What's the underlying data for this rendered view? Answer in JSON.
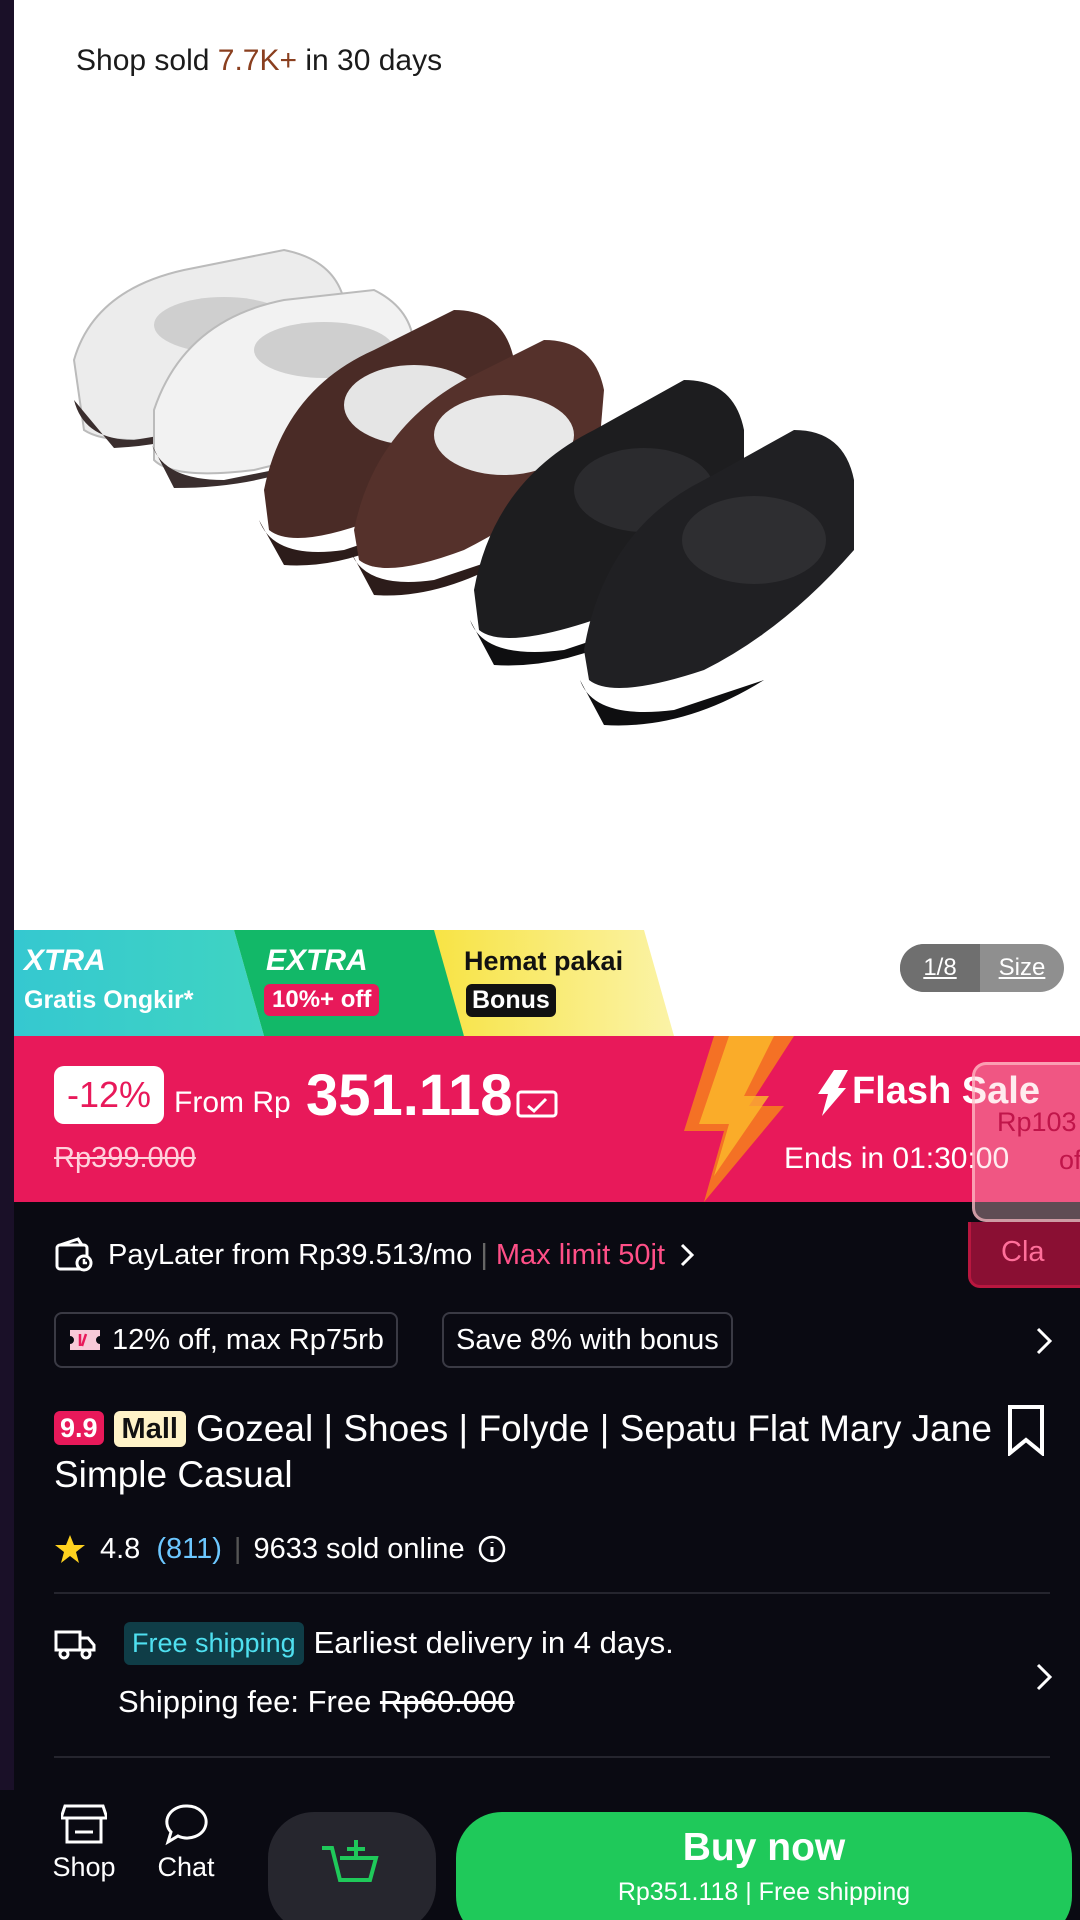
{
  "hero": {
    "sold_prefix": "Shop sold ",
    "sold_value": "7.7K+",
    "sold_suffix": " in 30 days",
    "pager": "1/8",
    "size_label": "Size"
  },
  "promos": {
    "xtra_title": "XTRA",
    "xtra_sub": "Gratis Ongkir*",
    "extra_title": "EXTRA",
    "extra_sub": "10%+ off",
    "hemat_title": "Hemat pakai",
    "hemat_sub": "Bonus"
  },
  "price": {
    "discount": "-12%",
    "from_label": "From Rp",
    "amount": "351.118",
    "original": "Rp399.000",
    "flash_label": "Flash Sale",
    "ends_in": "Ends in 01:30:00"
  },
  "overlay": {
    "price": "Rp103",
    "sub": "of",
    "claim": "Cla"
  },
  "paylater": {
    "text": "PayLater from Rp39.513/mo",
    "separator": "|",
    "limit": "Max limit 50jt"
  },
  "coupons": [
    {
      "label": "12% off, max Rp75rb"
    },
    {
      "label": "Save 8% with bonus"
    }
  ],
  "product": {
    "badge_99": "9.9",
    "badge_mall": "Mall",
    "title": "Gozeal | Shoes | Folyde | Sepatu Flat Mary Jane Simple Casual",
    "rating": "4.8",
    "reviews": "(811)",
    "separator": "|",
    "sold": "9633 sold online"
  },
  "shipping": {
    "badge": "Free shipping",
    "delivery": "Earliest delivery in 4 days.",
    "fee_label": "Shipping fee: Free ",
    "fee_original": "Rp60.000"
  },
  "bottom": {
    "shop": "Shop",
    "chat": "Chat",
    "buy_label": "Buy now",
    "buy_sub": "Rp351.118 | Free shipping"
  },
  "colors": {
    "accent": "#e8195a",
    "buy": "#1fc95a",
    "background": "#0a0a12"
  }
}
